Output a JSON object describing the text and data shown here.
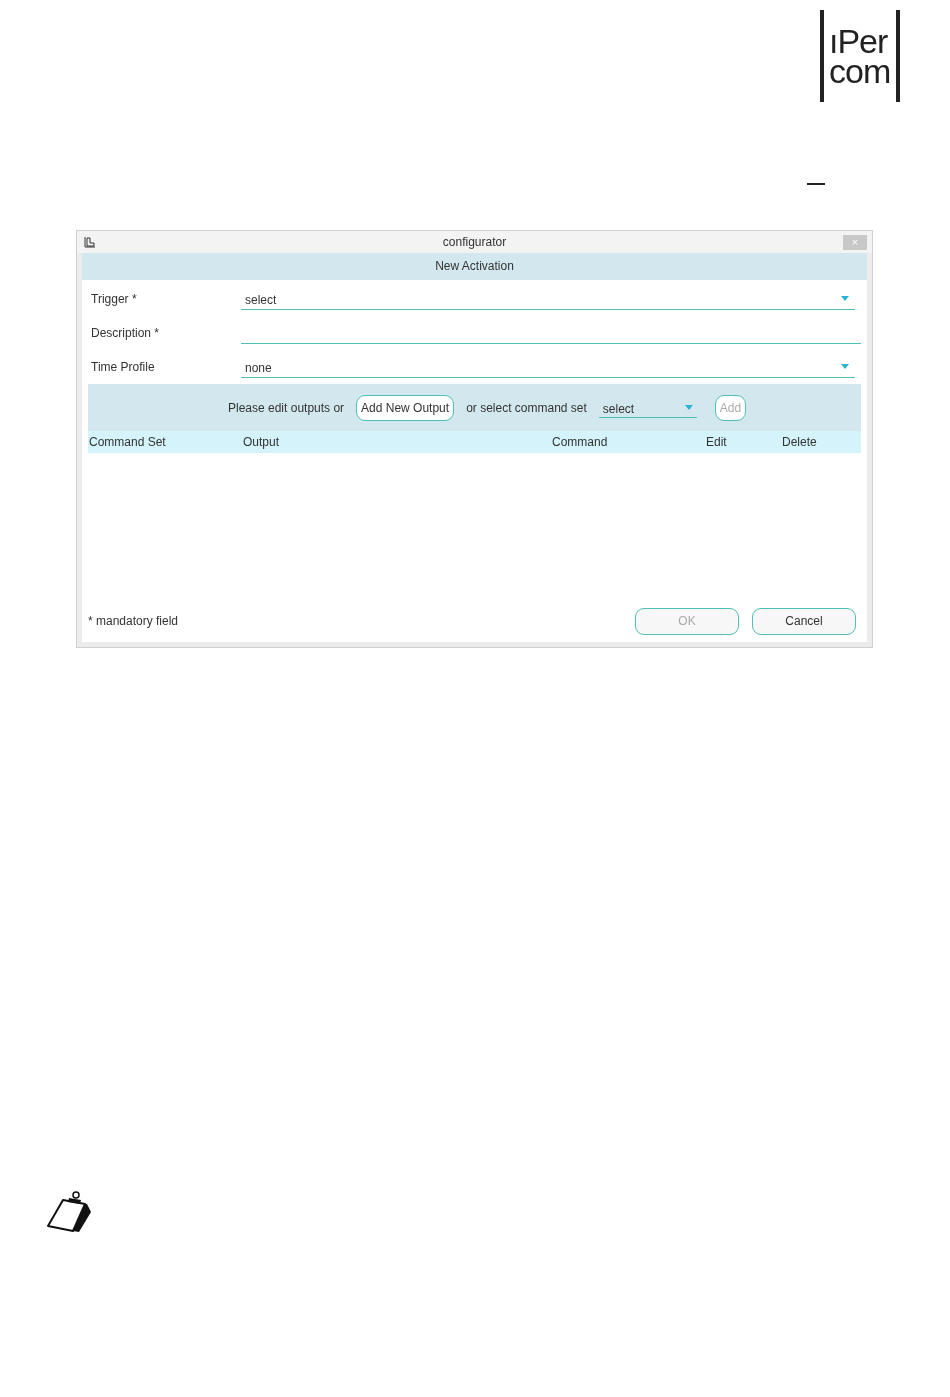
{
  "logo": {
    "lines": [
      "ıPer",
      "com"
    ]
  },
  "dialog": {
    "title": "configurator",
    "close": "×",
    "header": "New Activation",
    "fields": [
      {
        "label": "Trigger *",
        "kind": "dropdown",
        "value": "select"
      },
      {
        "label": "Description *",
        "kind": "text"
      },
      {
        "label": "Time Profile",
        "kind": "dropdown",
        "value": "none"
      }
    ],
    "toolbar": {
      "prompt": "Please edit outputs or",
      "add_output_button": "Add New Output",
      "command_set_label": "or select command set",
      "command_set_value": "select",
      "add_button": {
        "label": "Add",
        "disabled": true
      }
    },
    "table": {
      "columns": [
        "Command Set",
        "Output",
        "Command",
        "Edit",
        "Delete"
      ]
    },
    "footer_note": "* mandatory field",
    "buttons": [
      {
        "label": "OK",
        "disabled": true
      },
      {
        "label": "Cancel",
        "disabled": false
      }
    ]
  }
}
